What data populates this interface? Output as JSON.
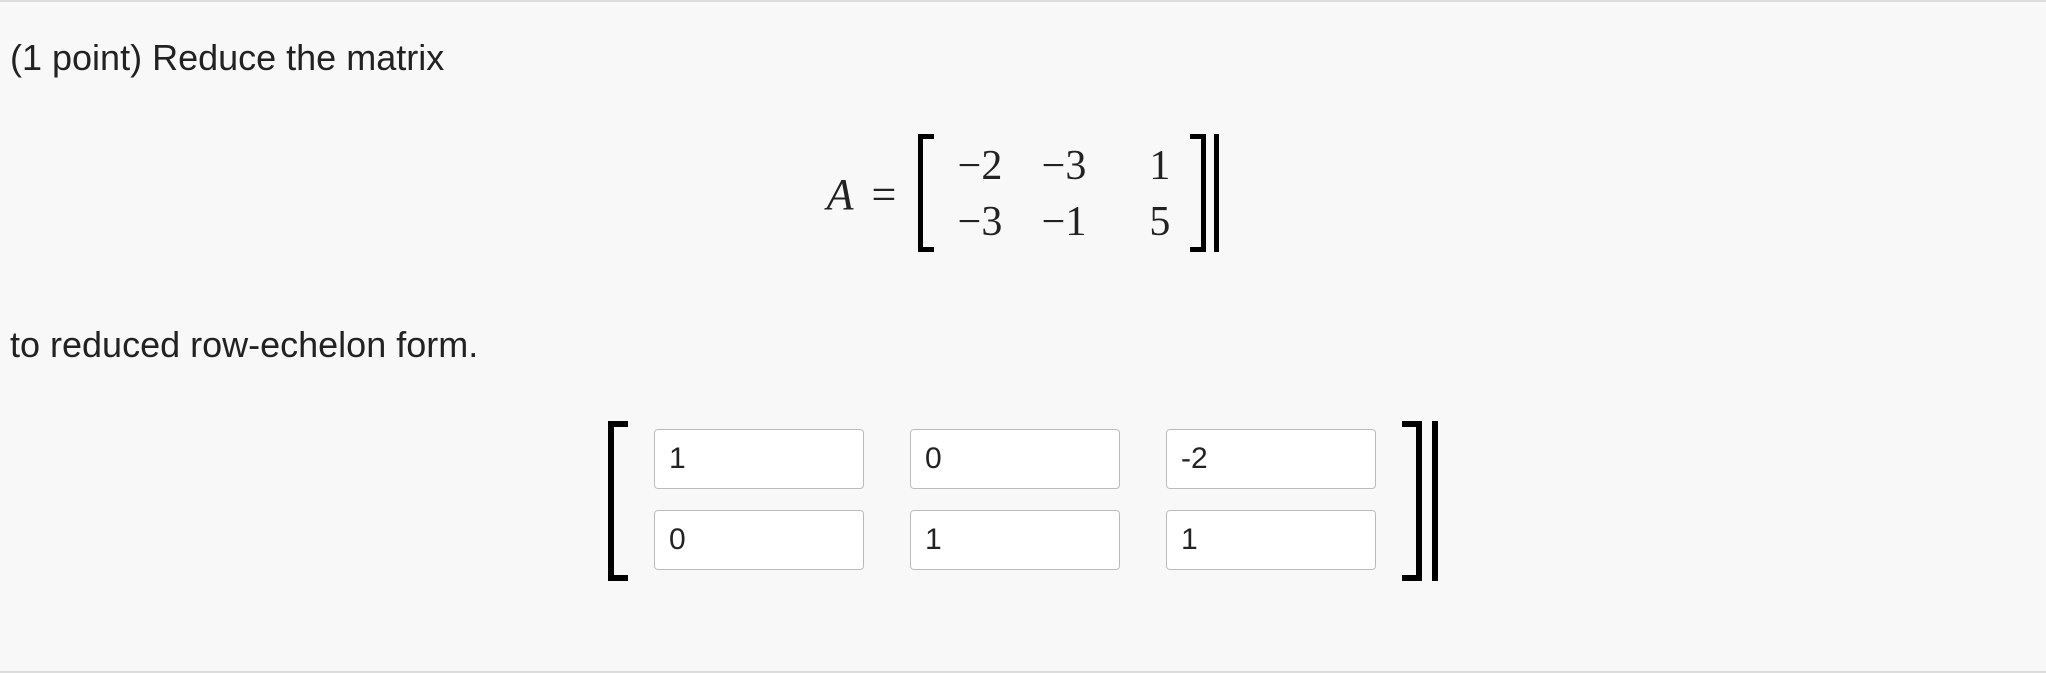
{
  "question": {
    "prefix": "(1 point) Reduce the matrix",
    "suffix": "to reduced row-echelon form."
  },
  "matrix": {
    "label": "A",
    "equals": "=",
    "rows": [
      [
        "−2",
        "−3",
        "1"
      ],
      [
        "−3",
        "−1",
        "5"
      ]
    ]
  },
  "answer": {
    "values": [
      [
        "1",
        "0",
        "-2"
      ],
      [
        "0",
        "1",
        "1"
      ]
    ]
  }
}
